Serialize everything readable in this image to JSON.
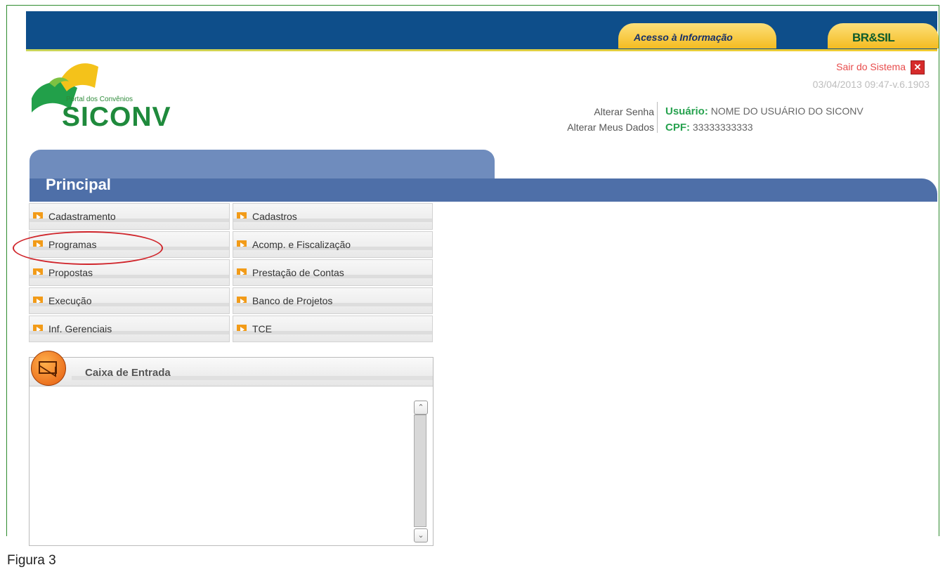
{
  "header": {
    "acesso_label": "Acesso à Informação",
    "brasil_label": "BR&SIL"
  },
  "logo": {
    "portal_text": "Portal dos Convênios",
    "name": "SICONV"
  },
  "session": {
    "logout_label": "Sair do Sistema",
    "logout_icon": "close-icon",
    "datetime": "03/04/2013 09:47-v.6.1903"
  },
  "user_links": {
    "change_password": "Alterar Senha",
    "change_data": "Alterar Meus Dados"
  },
  "user": {
    "user_label": "Usuário:",
    "user_value": "NOME DO USUÁRIO DO SICONV",
    "cpf_label": "CPF:",
    "cpf_value": "33333333333"
  },
  "section": {
    "title": "Principal"
  },
  "menu": {
    "items": [
      {
        "label": "Cadastramento"
      },
      {
        "label": "Cadastros"
      },
      {
        "label": "Programas"
      },
      {
        "label": "Acomp. e Fiscalização"
      },
      {
        "label": "Propostas"
      },
      {
        "label": "Prestação de Contas"
      },
      {
        "label": "Execução"
      },
      {
        "label": "Banco de Projetos"
      },
      {
        "label": "Inf. Gerenciais"
      },
      {
        "label": "TCE"
      }
    ]
  },
  "inbox": {
    "title": "Caixa de Entrada",
    "icon": "mail-icon"
  },
  "caption": "Figura 3",
  "colors": {
    "topbar": "#0e4e8a",
    "tab": "#4e6fa8",
    "accent_green": "#27a24f",
    "logout_red": "#e84c4c",
    "menu_arrow": "#f29b18",
    "highlight": "#d0252b"
  }
}
